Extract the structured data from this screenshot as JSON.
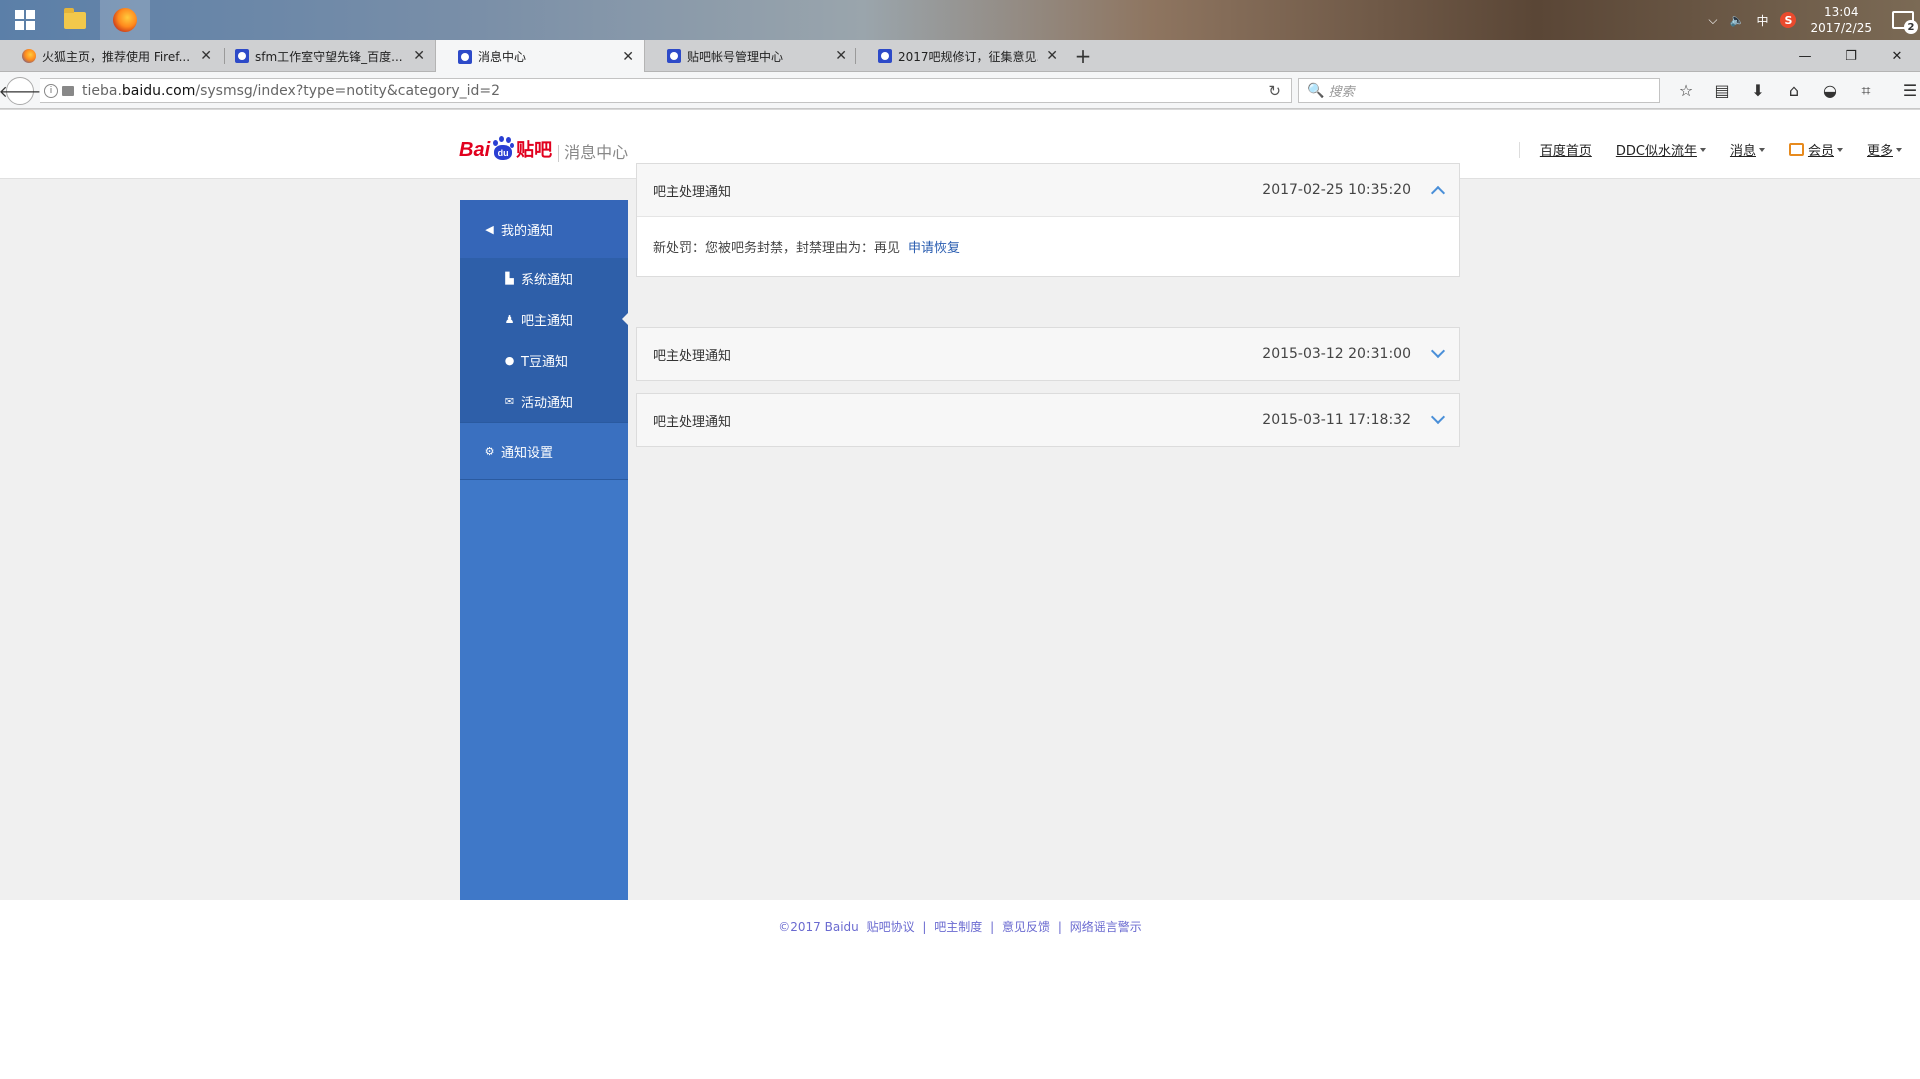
{
  "taskbar": {
    "tray_ime": "中",
    "tray_sogou": "S",
    "clock_time": "13:04",
    "clock_date": "2017/2/25",
    "notification_count": "2"
  },
  "browser": {
    "tabs": [
      {
        "title": "火狐主页，推荐使用 Firef..."
      },
      {
        "title": "sfm工作室守望先锋_百度..."
      },
      {
        "title": "消息中心"
      },
      {
        "title": "贴吧帐号管理中心"
      },
      {
        "title": "2017吧规修订，征集意见..."
      }
    ],
    "url_host_prefix": "tieba.",
    "url_host": "baidu.com",
    "url_path": "/sysmsg/index?type=notity&category_id=2",
    "search_placeholder": "搜索"
  },
  "header": {
    "logo_bai": "Bai",
    "logo_du": "du",
    "logo_tieba": "贴吧",
    "logo_subtitle": "消息中心",
    "nav": {
      "home": "百度首页",
      "user": "DDC似水流年",
      "messages": "消息",
      "vip": "会员",
      "more": "更多"
    }
  },
  "sidebar": {
    "my_notices": "我的通知",
    "items": [
      {
        "label": "系统通知",
        "icon": "flag-icon"
      },
      {
        "label": "吧主通知",
        "icon": "user-icon"
      },
      {
        "label": "T豆通知",
        "icon": "bean-icon"
      },
      {
        "label": "活动通知",
        "icon": "mail-icon"
      }
    ],
    "settings": "通知设置"
  },
  "notices": [
    {
      "title": "吧主处理通知",
      "time": "2017-02-25 10:35:20",
      "expanded": true,
      "body": "新处罚：您被吧务封禁，封禁理由为：再见",
      "action": "申请恢复"
    },
    {
      "title": "吧主处理通知",
      "time": "2015-03-12 20:31:00",
      "expanded": false
    },
    {
      "title": "吧主处理通知",
      "time": "2015-03-11 17:18:32",
      "expanded": false
    }
  ],
  "footer": {
    "copyright": "©2017 Baidu",
    "links": [
      "贴吧协议",
      "吧主制度",
      "意见反馈",
      "网络谣言警示"
    ],
    "separator": "|"
  },
  "colors": {
    "sidebar": "#3f78c8",
    "link": "#2a5db0",
    "logo_red": "#e1001e",
    "logo_blue": "#2a3fd3"
  }
}
